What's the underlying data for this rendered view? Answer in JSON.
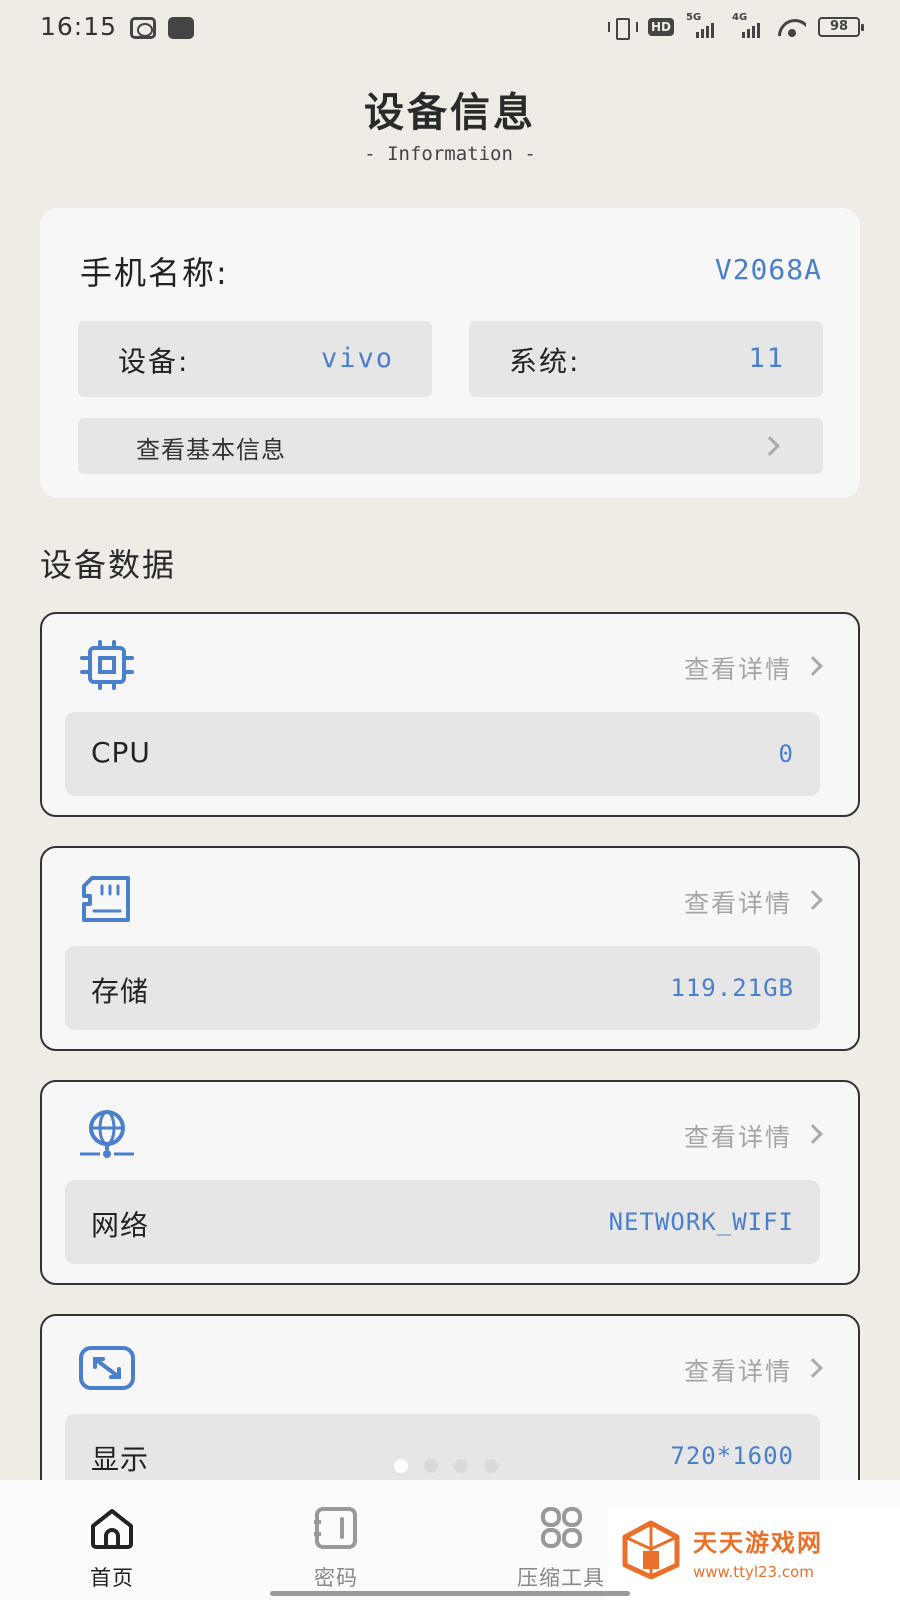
{
  "status_bar": {
    "time": "16:15",
    "hd_label": "HD",
    "net1_label": "5G",
    "net2_label": "4G",
    "battery": "98"
  },
  "header": {
    "title": "设备信息",
    "subtitle": "- Information -"
  },
  "info_card": {
    "phone_name_label": "手机名称:",
    "phone_name_value": "V2068A",
    "device_label": "设备:",
    "device_value": "vivo",
    "system_label": "系统:",
    "system_value": "11",
    "basic_info_label": "查看基本信息"
  },
  "section": {
    "title": "设备数据"
  },
  "data_cards": [
    {
      "icon": "cpu-chip-icon",
      "detail_label": "查看详情",
      "label": "CPU",
      "value": "0"
    },
    {
      "icon": "sd-card-icon",
      "detail_label": "查看详情",
      "label": "存储",
      "value": "119.21GB"
    },
    {
      "icon": "globe-network-icon",
      "detail_label": "查看详情",
      "label": "网络",
      "value": "NETWORK_WIFI"
    },
    {
      "icon": "screen-resize-icon",
      "detail_label": "查看详情",
      "label": "显示",
      "value": "720*1600"
    }
  ],
  "bottom_nav": {
    "items": [
      {
        "label": "首页",
        "icon": "home-icon",
        "active": true
      },
      {
        "label": "密码",
        "icon": "password-icon",
        "active": false
      },
      {
        "label": "压缩工具",
        "icon": "grid-icon",
        "active": false
      }
    ]
  },
  "watermark": {
    "name": "天天游戏网",
    "url": "www.ttyl23.com"
  },
  "colors": {
    "accent_blue": "#4a7fcb",
    "background": "#efece5",
    "card": "#f7f7f7",
    "row": "#e6e6e6",
    "watermark_orange": "#e8702a"
  }
}
